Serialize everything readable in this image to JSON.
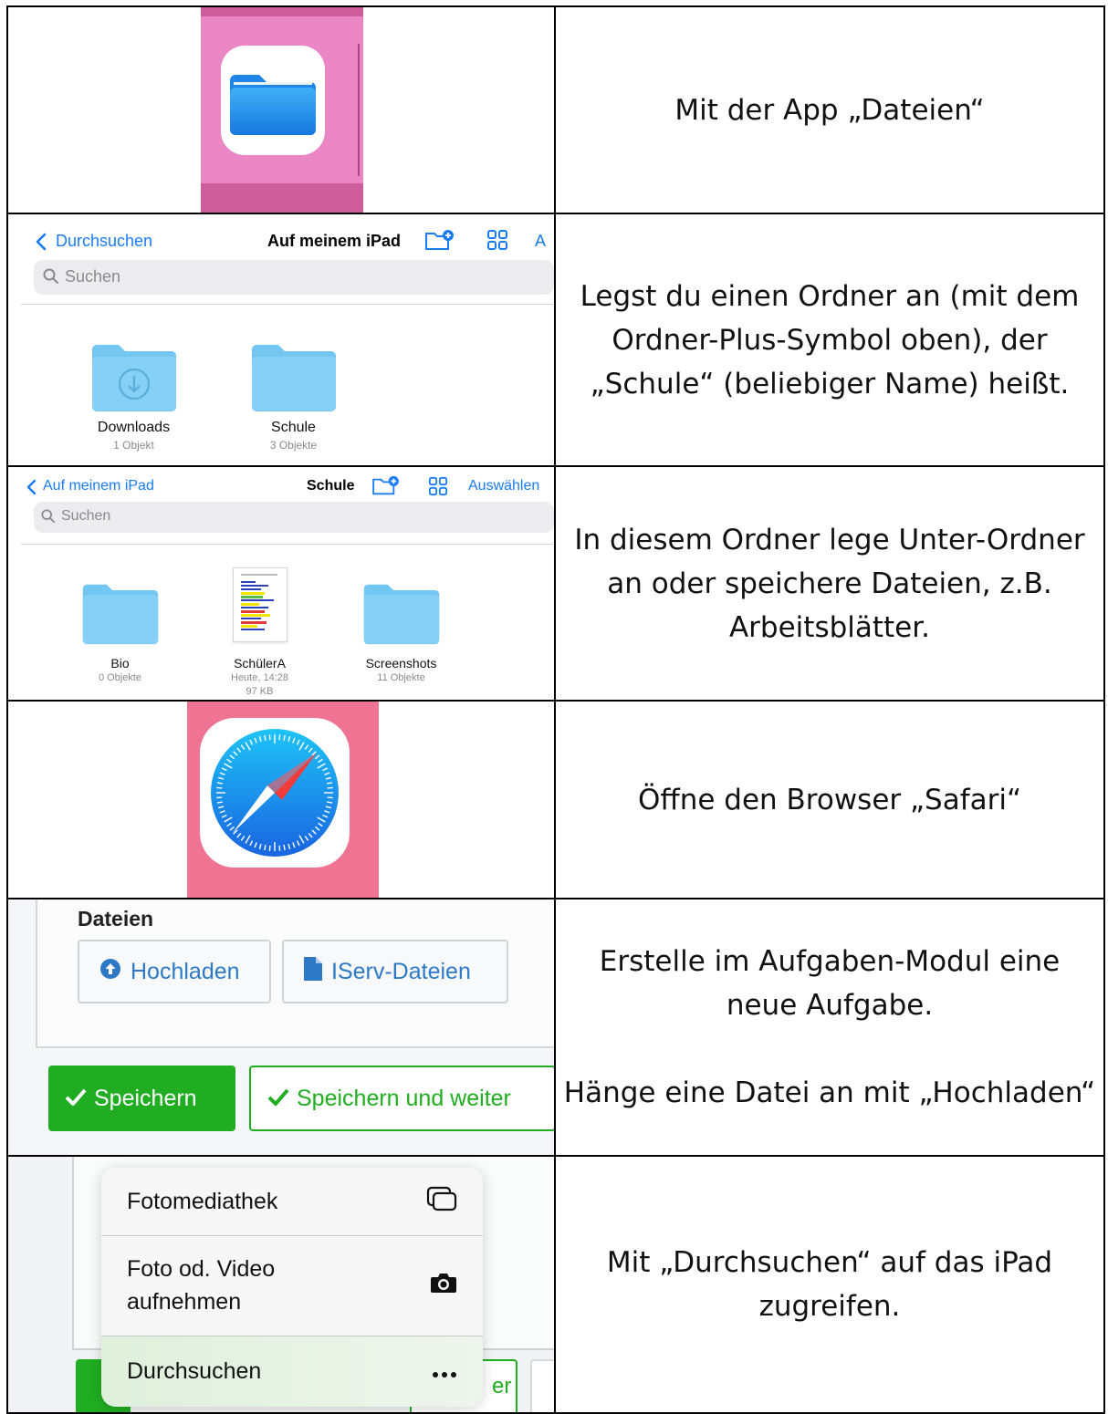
{
  "rows": [
    {
      "description": "Mit der App „Dateien“"
    },
    {
      "description": "Legst du einen Ordner an (mit dem\nOrdner-Plus-Symbol oben), der\n„Schule“ (beliebiger Name) heißt."
    },
    {
      "description": "In diesem Ordner lege Unter-Ordner\nan oder speichere Dateien, z.B.\nArbeitsblätter."
    },
    {
      "description": "Öffne den Browser „Safari“"
    },
    {
      "description": "Erstelle im Aufgaben-Modul eine\nneue Aufgabe.\n\nHänge eine Datei an mit „Hochladen“"
    },
    {
      "description": "Mit „Durchsuchen“ auf das iPad\nzugreifen."
    }
  ],
  "files_root": {
    "back_label": "Durchsuchen",
    "title": "Auf meinem iPad",
    "right_cut": "A",
    "search_placeholder": "Suchen",
    "folders": [
      {
        "name": "Downloads",
        "meta": "1 Objekt"
      },
      {
        "name": "Schule",
        "meta": "3 Objekte"
      }
    ]
  },
  "files_schule": {
    "back_label": "Auf meinem iPad",
    "title": "Schule",
    "select_label": "Auswählen",
    "search_placeholder": "Suchen",
    "items": [
      {
        "name": "Bio",
        "meta": "0 Objekte"
      },
      {
        "name": "SchülerA",
        "meta": "Heute, 14:28",
        "meta2": "97 KB"
      },
      {
        "name": "Screenshots",
        "meta": "11 Objekte"
      }
    ]
  },
  "iserv": {
    "section_title": "Dateien",
    "upload_label": "Hochladen",
    "iserv_files_label": "IServ-Dateien",
    "save_label": "Speichern",
    "save_continue_label": "Speichern und weiter"
  },
  "ios_menu": {
    "items": [
      {
        "label": "Fotomediathek",
        "icon": "photo-library-icon"
      },
      {
        "label": "Foto od. Video\naufnehmen",
        "icon": "camera-icon"
      },
      {
        "label": "Durchsuchen",
        "icon": "more-icon"
      }
    ],
    "behind_text": "er"
  },
  "colors": {
    "ios_blue": "#1a7cf5",
    "iserv_green": "#21ad21",
    "iserv_blue": "#2e79c6"
  }
}
